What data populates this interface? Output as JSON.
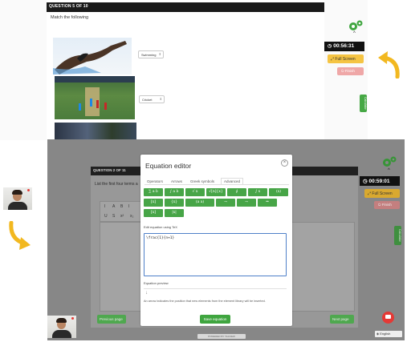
{
  "screen1": {
    "question_number": "QUESTION 5 OF 10",
    "instruction": "Match the following",
    "selects": [
      "Swimming",
      "Cricket"
    ],
    "timer": "00:56:31",
    "full_screen_label": "Full Screen",
    "finish_label": "Finish",
    "side_tab_label": "Calculator"
  },
  "screen2": {
    "question_number": "QUESTION 2 OF 11",
    "instruction": "List the first four terms a",
    "toolbar_row1": [
      "I",
      "A",
      "B",
      "I"
    ],
    "toolbar_row2": [
      "U",
      "S",
      "x²",
      "x₂"
    ],
    "timer": "00:59:01",
    "full_screen_label": "Full Screen",
    "finish_label": "Finish",
    "side_tab_label": "Calculator",
    "previous_label": "Previous page",
    "next_label": "Next page",
    "footer": "POWERED BY TALVIEW",
    "language": "English"
  },
  "equation_editor": {
    "title": "Equation editor",
    "tabs": [
      "Operators",
      "Arrows",
      "Greek symbols",
      "Advanced"
    ],
    "active_tab": "Advanced",
    "symbol_rows": [
      [
        "∑ a b",
        "∫ a b",
        "√ x",
        "√[n]{x}",
        "∮",
        "∫ x",
        "(x)"
      ],
      [
        "[x]",
        "{x}",
        "(a  a)",
        "→",
        "→",
        "⇒"
      ],
      [
        "[x]",
        "|x|"
      ]
    ],
    "edit_label": "Edit equation using TeX",
    "tex_value": "\\frac{1}{n+1}",
    "preview_label": "Equation preview",
    "preview_glyph": "↓",
    "note": "An arrow indicates the position that new elements from the element library will be inserted.",
    "save_label": "Save equation"
  },
  "colors": {
    "accent_green": "#47a547",
    "timer_bg": "#111111",
    "full_screen_yellow": "#f5c443",
    "finish_pink": "#efa7a7",
    "arrow_orange": "#f2b820",
    "chat_red": "#e53935"
  },
  "icons": [
    "settings-gear-icon",
    "clock-icon",
    "expand-icon",
    "power-icon",
    "curved-arrow-icon",
    "chat-icon",
    "globe-icon",
    "close-icon"
  ]
}
